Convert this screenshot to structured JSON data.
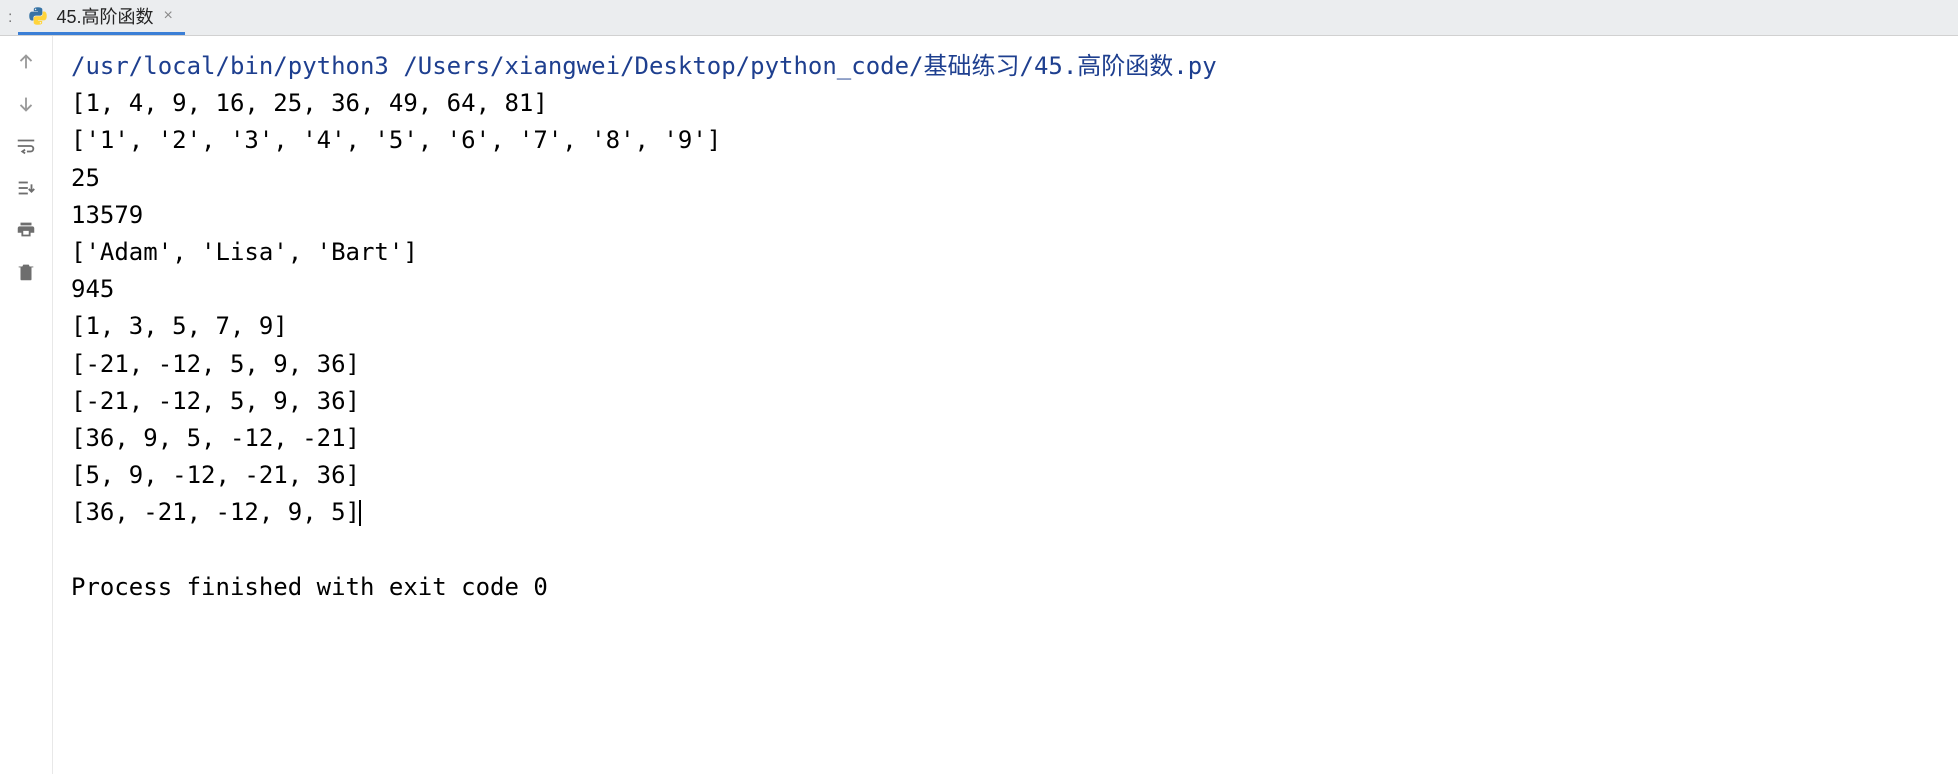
{
  "tabBar": {
    "prefix": ":",
    "tab": {
      "label": "45.高阶函数",
      "closeChar": "×"
    }
  },
  "console": {
    "command": "/usr/local/bin/python3 /Users/xiangwei/Desktop/python_code/基础练习/45.高阶函数.py",
    "outputLines": [
      "[1, 4, 9, 16, 25, 36, 49, 64, 81]",
      "['1', '2', '3', '4', '5', '6', '7', '8', '9']",
      "25",
      "13579",
      "['Adam', 'Lisa', 'Bart']",
      "945",
      "[1, 3, 5, 7, 9]",
      "[-21, -12, 5, 9, 36]",
      "[-21, -12, 5, 9, 36]",
      "[36, 9, 5, -12, -21]",
      "[5, 9, -12, -21, 36]",
      "[36, -21, -12, 9, 5]"
    ],
    "exitMessage": "Process finished with exit code 0"
  },
  "gutter": {
    "icons": [
      "arrow-up-icon",
      "arrow-down-icon",
      "soft-wrap-icon",
      "scroll-to-end-icon",
      "print-icon",
      "delete-icon"
    ]
  }
}
